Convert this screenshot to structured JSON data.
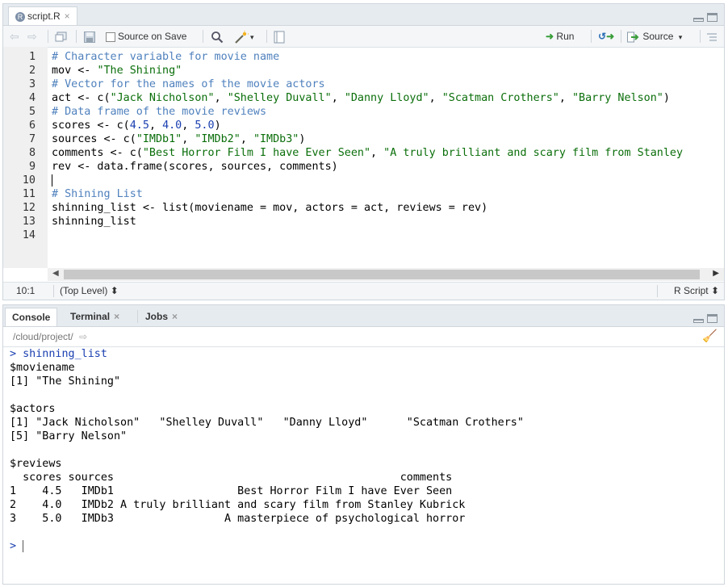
{
  "editor": {
    "tab_label": "script.R",
    "tab_close": "×",
    "toolbar": {
      "source_on_save": "Source on Save",
      "run": "Run",
      "source": "Source",
      "source_dropdown": "▾"
    },
    "lines": [
      {
        "n": "1",
        "parts": [
          {
            "t": "# Character variable for movie name",
            "k": "c"
          }
        ]
      },
      {
        "n": "2",
        "parts": [
          {
            "t": "mov <- ",
            "k": ""
          },
          {
            "t": "\"The Shining\"",
            "k": "s"
          }
        ]
      },
      {
        "n": "3",
        "parts": [
          {
            "t": "# Vector for the names of the movie actors",
            "k": "c"
          }
        ]
      },
      {
        "n": "4",
        "parts": [
          {
            "t": "act <- c(",
            "k": ""
          },
          {
            "t": "\"Jack Nicholson\"",
            "k": "s"
          },
          {
            "t": ", ",
            "k": ""
          },
          {
            "t": "\"Shelley Duvall\"",
            "k": "s"
          },
          {
            "t": ", ",
            "k": ""
          },
          {
            "t": "\"Danny Lloyd\"",
            "k": "s"
          },
          {
            "t": ", ",
            "k": ""
          },
          {
            "t": "\"Scatman Crothers\"",
            "k": "s"
          },
          {
            "t": ", ",
            "k": ""
          },
          {
            "t": "\"Barry Nelson\"",
            "k": "s"
          },
          {
            "t": ")",
            "k": ""
          }
        ]
      },
      {
        "n": "5",
        "parts": [
          {
            "t": "# Data frame of the movie reviews",
            "k": "c"
          }
        ]
      },
      {
        "n": "6",
        "parts": [
          {
            "t": "scores <- c(",
            "k": ""
          },
          {
            "t": "4.5",
            "k": "n"
          },
          {
            "t": ", ",
            "k": ""
          },
          {
            "t": "4.0",
            "k": "n"
          },
          {
            "t": ", ",
            "k": ""
          },
          {
            "t": "5.0",
            "k": "n"
          },
          {
            "t": ")",
            "k": ""
          }
        ]
      },
      {
        "n": "7",
        "parts": [
          {
            "t": "sources <- c(",
            "k": ""
          },
          {
            "t": "\"IMDb1\"",
            "k": "s"
          },
          {
            "t": ", ",
            "k": ""
          },
          {
            "t": "\"IMDb2\"",
            "k": "s"
          },
          {
            "t": ", ",
            "k": ""
          },
          {
            "t": "\"IMDb3\"",
            "k": "s"
          },
          {
            "t": ")",
            "k": ""
          }
        ]
      },
      {
        "n": "8",
        "parts": [
          {
            "t": "comments <- c(",
            "k": ""
          },
          {
            "t": "\"Best Horror Film I have Ever Seen\"",
            "k": "s"
          },
          {
            "t": ", ",
            "k": ""
          },
          {
            "t": "\"A truly brilliant and scary film from Stanley",
            "k": "s"
          }
        ]
      },
      {
        "n": "9",
        "parts": [
          {
            "t": "rev <- data.frame(scores, sources, comments)",
            "k": ""
          }
        ]
      },
      {
        "n": "10",
        "parts": []
      },
      {
        "n": "11",
        "parts": [
          {
            "t": "# Shining List",
            "k": "c"
          }
        ]
      },
      {
        "n": "12",
        "parts": [
          {
            "t": "shinning_list <- list(moviename = mov, actors = act, reviews = rev)",
            "k": ""
          }
        ]
      },
      {
        "n": "13",
        "parts": [
          {
            "t": "shinning_list",
            "k": ""
          }
        ]
      },
      {
        "n": "14",
        "parts": []
      }
    ],
    "status": {
      "cursor": "10:1",
      "scope": "(Top Level) ⬍",
      "filetype": "R Script ⬍"
    }
  },
  "console": {
    "tabs": [
      {
        "label": "Console",
        "close": ""
      },
      {
        "label": "Terminal",
        "close": "×"
      },
      {
        "label": "Jobs",
        "close": "×"
      }
    ],
    "path": "/cloud/project/",
    "lines": [
      {
        "t": "> shinning_list",
        "prompt": true
      },
      {
        "t": "$moviename",
        "prompt": false
      },
      {
        "t": "[1] \"The Shining\"",
        "prompt": false
      },
      {
        "t": "",
        "prompt": false
      },
      {
        "t": "$actors",
        "prompt": false
      },
      {
        "t": "[1] \"Jack Nicholson\"   \"Shelley Duvall\"   \"Danny Lloyd\"      \"Scatman Crothers\"",
        "prompt": false
      },
      {
        "t": "[5] \"Barry Nelson\"",
        "prompt": false
      },
      {
        "t": "",
        "prompt": false
      },
      {
        "t": "$reviews",
        "prompt": false
      },
      {
        "t": "  scores sources                                            comments",
        "prompt": false
      },
      {
        "t": "1    4.5   IMDb1                   Best Horror Film I have Ever Seen",
        "prompt": false
      },
      {
        "t": "2    4.0   IMDb2 A truly brilliant and scary film from Stanley Kubrick",
        "prompt": false
      },
      {
        "t": "3    5.0   IMDb3                 A masterpiece of psychological horror",
        "prompt": false
      },
      {
        "t": "",
        "prompt": false
      },
      {
        "t": "> ",
        "prompt": true
      }
    ]
  },
  "colors": {
    "comment": "#4f81bd",
    "string": "#0a6e0a",
    "number": "#1a3fb0",
    "prompt": "#1a3fb0"
  }
}
